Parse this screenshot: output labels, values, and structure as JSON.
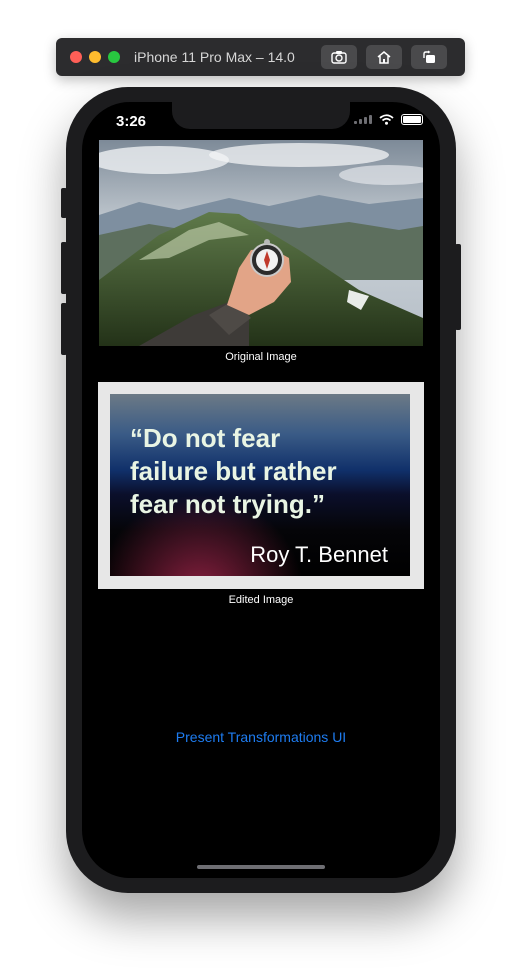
{
  "simulator": {
    "title": "iPhone 11 Pro Max – 14.0",
    "buttons": [
      "screenshot-icon",
      "home-icon",
      "rotate-icon"
    ]
  },
  "status_bar": {
    "time": "3:26",
    "icons": [
      "signal-icon",
      "wifi-icon",
      "battery-icon"
    ]
  },
  "original": {
    "caption": "Original Image"
  },
  "edited": {
    "quote": "“Do not fear\nfailure but rather\nfear not trying.”",
    "author": "Roy T. Bennet",
    "caption": "Edited Image"
  },
  "actions": {
    "present_label": "Present Transformations UI"
  },
  "colors": {
    "accent": "#1e7cf0",
    "screen_background": "#000000",
    "quote_text": "#e9f5e4"
  }
}
